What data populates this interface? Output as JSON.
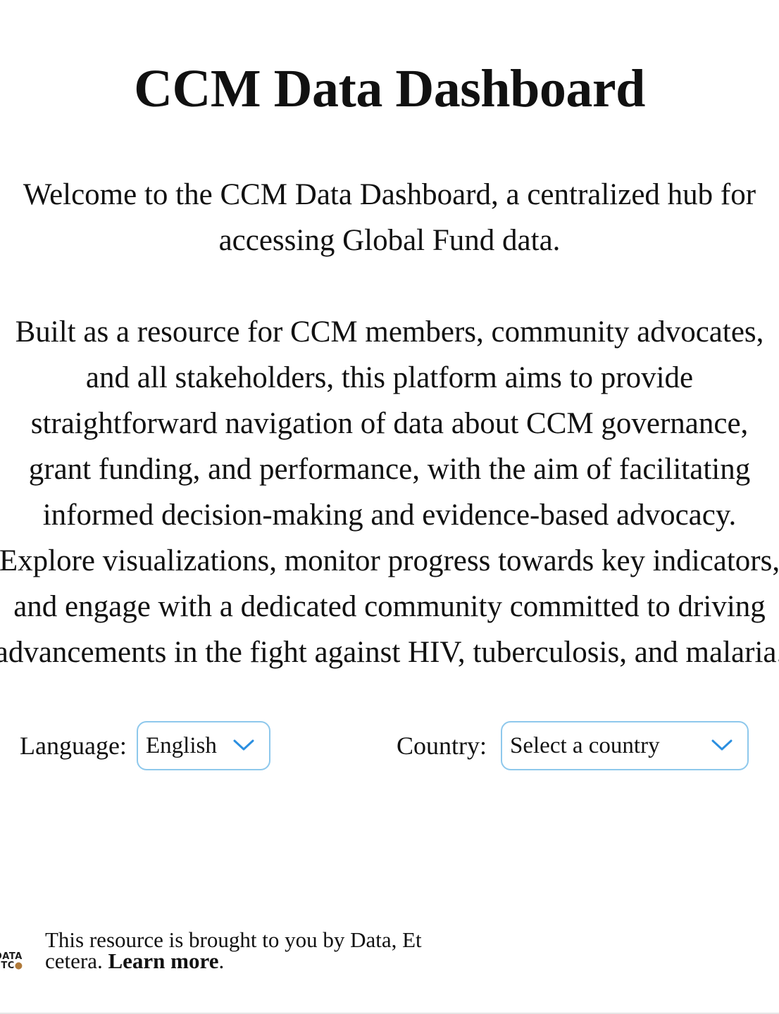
{
  "header": {
    "title": "CCM Data Dashboard"
  },
  "intro": {
    "paragraph1_lines": [
      "Welcome to the CCM Data Dashboard, a centralized hub for",
      "accessing Global Fund data."
    ],
    "paragraph2_lines": [
      "Built as a resource for CCM members, community advocates,",
      "and all stakeholders, this platform aims to provide",
      "straightforward navigation of data about CCM governance,",
      "grant funding, and performance, with the aim of facilitating",
      "informed decision-making and evidence-based advocacy.",
      "Explore visualizations, monitor progress towards key indicators,",
      "and engage with a dedicated community committed to driving",
      "advancements in the fight against HIV, tuberculosis, and malaria."
    ]
  },
  "controls": {
    "language_label": "Language:",
    "language_value": "English",
    "country_label": "Country:",
    "country_placeholder": "Select a country"
  },
  "footer": {
    "logo_row1": "DATA",
    "logo_row2": "ETC",
    "text": "This resource is brought to you by Data, Et cetera.",
    "link_text": "Learn more",
    "link_suffix": "."
  },
  "colors": {
    "select_border": "#8ec8ec",
    "chevron": "#2b8fe0"
  }
}
